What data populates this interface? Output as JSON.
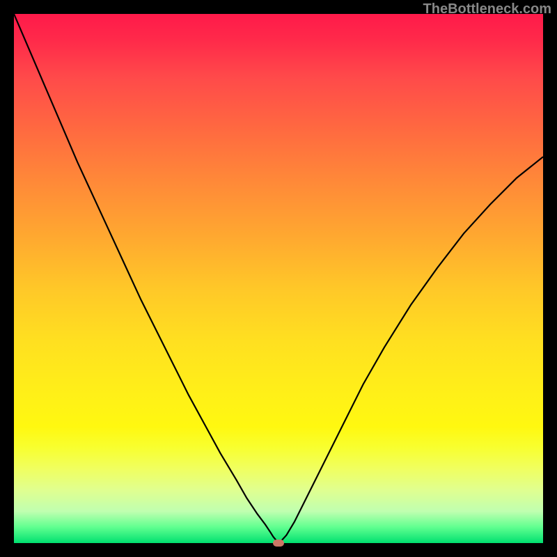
{
  "watermark": "TheBottleneck.com",
  "chart_data": {
    "type": "line",
    "title": "",
    "xlabel": "",
    "ylabel": "",
    "xlim": [
      0,
      100
    ],
    "ylim": [
      0,
      100
    ],
    "grid": false,
    "x": [
      0,
      3,
      6,
      9,
      12,
      15,
      18,
      21,
      24,
      27,
      30,
      33,
      36,
      39,
      42,
      44,
      46,
      47.5,
      48.5,
      49,
      49.5,
      50,
      50.5,
      51.5,
      53,
      55,
      58,
      62,
      66,
      70,
      75,
      80,
      85,
      90,
      95,
      100
    ],
    "values": [
      100,
      93,
      86,
      79,
      72,
      65.5,
      59,
      52.5,
      46,
      40,
      34,
      28,
      22.5,
      17,
      12,
      8.5,
      5.5,
      3.5,
      2,
      1.2,
      0.6,
      0.2,
      0.4,
      1.5,
      4,
      8,
      14,
      22,
      30,
      37,
      45,
      52,
      58.5,
      64,
      69,
      73
    ],
    "marker": {
      "x": 50,
      "y": 0
    },
    "background_gradient": {
      "type": "vertical",
      "stops": [
        {
          "pos": 0.0,
          "color": "#ff1a4a"
        },
        {
          "pos": 0.5,
          "color": "#ffc020"
        },
        {
          "pos": 0.85,
          "color": "#f0ff40"
        },
        {
          "pos": 1.0,
          "color": "#00e070"
        }
      ]
    }
  }
}
